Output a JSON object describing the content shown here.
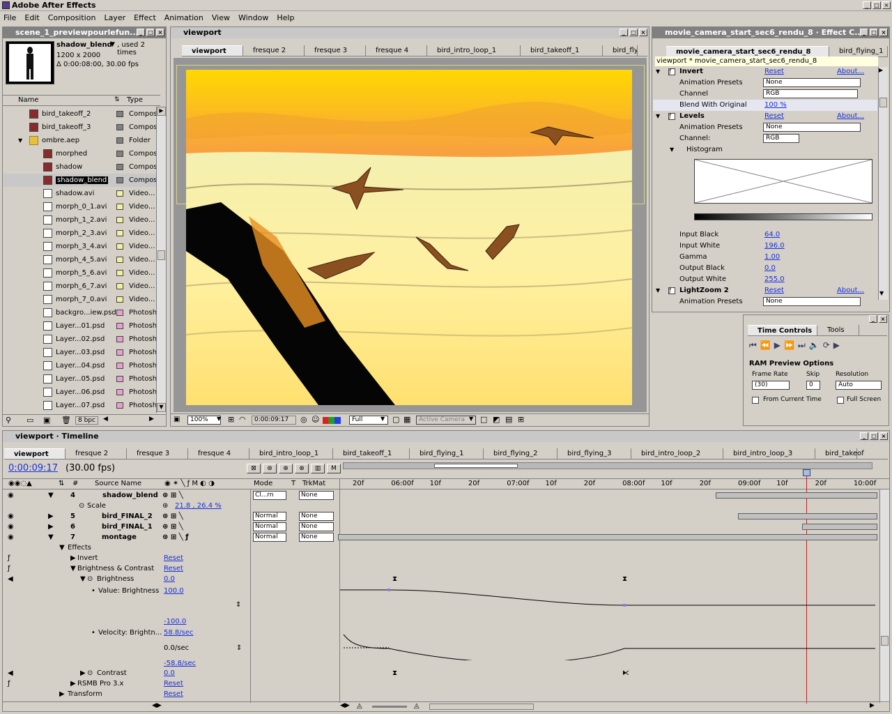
{
  "app": {
    "title": "Adobe After Effects"
  },
  "menu": [
    "File",
    "Edit",
    "Composition",
    "Layer",
    "Effect",
    "Animation",
    "View",
    "Window",
    "Help"
  ],
  "project": {
    "tab": "scene_1_previewpourlefun...",
    "selected_name": "shadow_blend",
    "used": ", used 2 times",
    "size": "1200 x 2000",
    "duration": "Δ 0:00:08:00, 30.00 fps",
    "col_name": "Name",
    "col_type": "Type",
    "items": [
      {
        "name": "bird_takeoff_2",
        "type": "Composit",
        "icon": "comp",
        "indent": 0,
        "swatch": "#808080"
      },
      {
        "name": "bird_takeoff_3",
        "type": "Composit",
        "icon": "comp",
        "indent": 0,
        "swatch": "#808080"
      },
      {
        "name": "ombre.aep",
        "type": "Folder",
        "icon": "fold",
        "indent": 0,
        "swatch": "#808080",
        "open": true
      },
      {
        "name": "morphed",
        "type": "Composit",
        "icon": "comp",
        "indent": 1,
        "swatch": "#808080"
      },
      {
        "name": "shadow",
        "type": "Composit",
        "icon": "comp",
        "indent": 1,
        "swatch": "#808080"
      },
      {
        "name": "shadow_blend",
        "type": "Composit",
        "icon": "comp",
        "indent": 1,
        "swatch": "#808080",
        "selected": true
      },
      {
        "name": "shadow.avi",
        "type": "Video... M",
        "icon": "vid",
        "indent": 1,
        "swatch": "#f0f0a0"
      },
      {
        "name": "morph_0_1.avi",
        "type": "Video... M",
        "icon": "vid",
        "indent": 1,
        "swatch": "#f0f0a0"
      },
      {
        "name": "morph_1_2.avi",
        "type": "Video... M",
        "icon": "vid",
        "indent": 1,
        "swatch": "#f0f0a0"
      },
      {
        "name": "morph_2_3.avi",
        "type": "Video... M",
        "icon": "vid",
        "indent": 1,
        "swatch": "#f0f0a0"
      },
      {
        "name": "morph_3_4.avi",
        "type": "Video... M",
        "icon": "vid",
        "indent": 1,
        "swatch": "#f0f0a0"
      },
      {
        "name": "morph_4_5.avi",
        "type": "Video... M",
        "icon": "vid",
        "indent": 1,
        "swatch": "#f0f0a0"
      },
      {
        "name": "morph_5_6.avi",
        "type": "Video... M",
        "icon": "vid",
        "indent": 1,
        "swatch": "#f0f0a0"
      },
      {
        "name": "morph_6_7.avi",
        "type": "Video... M",
        "icon": "vid",
        "indent": 1,
        "swatch": "#f0f0a0"
      },
      {
        "name": "morph_7_0.avi",
        "type": "Video... M",
        "icon": "vid",
        "indent": 1,
        "swatch": "#f0f0a0"
      },
      {
        "name": "backgro...iew.psd",
        "type": "Photosho",
        "icon": "ps",
        "indent": 1,
        "swatch": "#e8a0d0"
      },
      {
        "name": "Layer...01.psd",
        "type": "Photosho",
        "icon": "ps",
        "indent": 1,
        "swatch": "#e8a0d0"
      },
      {
        "name": "Layer...02.psd",
        "type": "Photosho",
        "icon": "ps",
        "indent": 1,
        "swatch": "#e8a0d0"
      },
      {
        "name": "Layer...03.psd",
        "type": "Photosho",
        "icon": "ps",
        "indent": 1,
        "swatch": "#e8a0d0"
      },
      {
        "name": "Layer...04.psd",
        "type": "Photosho",
        "icon": "ps",
        "indent": 1,
        "swatch": "#e8a0d0"
      },
      {
        "name": "Layer...05.psd",
        "type": "Photosho",
        "icon": "ps",
        "indent": 1,
        "swatch": "#e8a0d0"
      },
      {
        "name": "Layer...06.psd",
        "type": "Photosho",
        "icon": "ps",
        "indent": 1,
        "swatch": "#e8a0d0"
      },
      {
        "name": "Layer...07.psd",
        "type": "Photosho",
        "icon": "ps",
        "indent": 1,
        "swatch": "#e8a0d0"
      }
    ],
    "bpc": "8 bpc"
  },
  "viewport": {
    "title": "viewport",
    "tabs": [
      "viewport",
      "fresque 2",
      "fresque 3",
      "fresque 4",
      "bird_intro_loop_1",
      "bird_takeoff_1",
      "bird_flying"
    ],
    "zoom": "100%",
    "time": "0:00:09:17",
    "resolution": "Full",
    "camera": "Active Camera"
  },
  "effects": {
    "title": "movie_camera_start_sec6_rendu_8 · Effect C...",
    "tabs": [
      "movie_camera_start_sec6_rendu_8",
      "bird_flying_1"
    ],
    "path": "viewport * movie_camera_start_sec6_rendu_8",
    "reset": "Reset",
    "about": "About...",
    "invert": "Invert",
    "anim_presets": "Animation Presets",
    "none": "None",
    "channel": "Channel",
    "channel_val": "RGB",
    "blend": "Blend With Original",
    "blend_val": "100 %",
    "levels": "Levels",
    "channel2": "Channel:",
    "histogram": "Histogram",
    "params": [
      {
        "label": "Input Black",
        "value": "64.0"
      },
      {
        "label": "Input White",
        "value": "196.0"
      },
      {
        "label": "Gamma",
        "value": "1.00"
      },
      {
        "label": "Output Black",
        "value": "0.0"
      },
      {
        "label": "Output White",
        "value": "255.0"
      }
    ],
    "lightzoom": "LightZoom 2"
  },
  "time_controls": {
    "tab1": "Time Controls",
    "tab2": "Tools",
    "ram": "RAM Preview Options",
    "fr_label": "Frame Rate",
    "skip_label": "Skip",
    "res_label": "Resolution",
    "fr": "(30)",
    "skip": "0",
    "res": "Auto",
    "from_current": "From Current Time",
    "full_screen": "Full Screen"
  },
  "timeline": {
    "title": "viewport · Timeline",
    "tabs": [
      "viewport",
      "fresque 2",
      "fresque 3",
      "fresque 4",
      "bird_intro_loop_1",
      "bird_takeoff_1",
      "bird_flying_1",
      "bird_flying_2",
      "bird_flying_3",
      "bird_intro_loop_2",
      "bird_intro_loop_3",
      "bird_takeof"
    ],
    "timecode": "0:00:09:17",
    "fps": "(30.00 fps)",
    "col_num": "#",
    "col_source": "Source Name",
    "col_mode": "Mode",
    "col_t": "T",
    "col_trk": "TrkMat",
    "ruler": [
      "20f",
      "06:00f",
      "10f",
      "20f",
      "07:00f",
      "10f",
      "20f",
      "08:00f",
      "10f",
      "20f",
      "09:00f",
      "10f",
      "20f",
      "10:00f"
    ],
    "rows": {
      "l4_num": "4",
      "l4_name": "shadow_blend",
      "l4_mode": "Cl...rn",
      "l4_trk": "None",
      "scale": "Scale",
      "scale_val": "21.8 , 26.4 %",
      "l5_num": "5",
      "l5_name": "bird_FINAL_2",
      "l5_mode": "Normal",
      "l5_trk": "None",
      "l6_num": "6",
      "l6_name": "bird_FINAL_1",
      "l6_mode": "Normal",
      "l6_trk": "None",
      "l7_num": "7",
      "l7_name": "montage",
      "l7_mode": "Normal",
      "l7_trk": "None",
      "effects": "Effects",
      "invert": "Invert",
      "reset": "Reset",
      "bc": "Brightness & Contrast",
      "brightness": "Brightness",
      "brightness_val": "0.0",
      "value_label": "Value: Brightness",
      "value_top": "100.0",
      "value_bot": "-100.0",
      "vel_label": "Velocity: Brightn...",
      "vel_top": "58.8/sec",
      "vel_mid": "0.0/sec",
      "vel_bot": "-58.8/sec",
      "contrast": "Contrast",
      "contrast_val": "0.0",
      "rsmb": "RSMB Pro 3.x",
      "transform": "Transform"
    }
  }
}
